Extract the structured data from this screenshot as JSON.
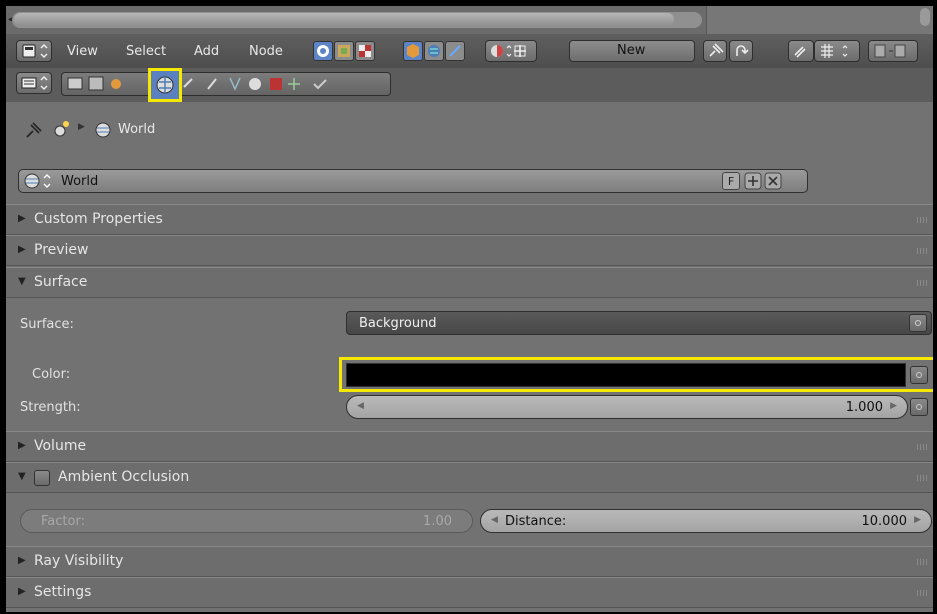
{
  "header": {
    "menus": [
      "View",
      "Select",
      "Add",
      "Node"
    ],
    "new_label": "New"
  },
  "breadcrumb": {
    "label": "World"
  },
  "datablock": {
    "name": "World",
    "fake_user": "F"
  },
  "panels": {
    "custom_properties": "Custom Properties",
    "preview": "Preview",
    "surface": "Surface",
    "volume": "Volume",
    "ambient_occlusion": "Ambient Occlusion",
    "ray_visibility": "Ray Visibility",
    "settings": "Settings"
  },
  "surface": {
    "surface_label": "Surface:",
    "surface_value": "Background",
    "color_label": "Color:",
    "color_value": "#000000",
    "strength_label": "Strength:",
    "strength_value": "1.000"
  },
  "ao": {
    "factor_label": "Factor:",
    "factor_value": "1.00",
    "distance_label": "Distance:",
    "distance_value": "10.000",
    "enabled": false
  },
  "active_tab": "world-tab",
  "colors": {
    "highlight": "#f5e900"
  }
}
